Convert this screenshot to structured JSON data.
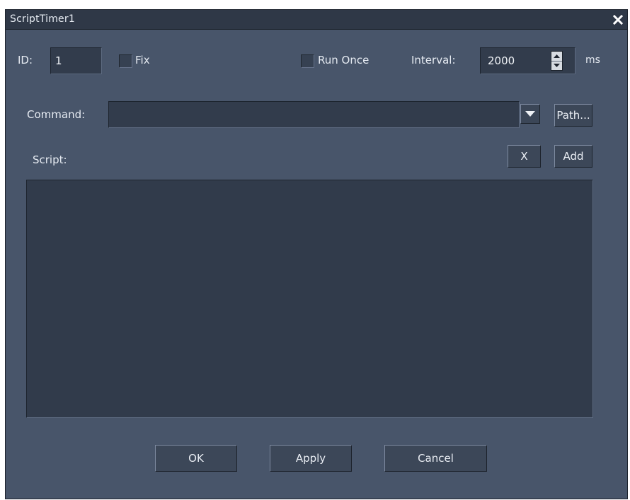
{
  "window": {
    "title": "ScriptTimer1"
  },
  "icons": {
    "close": "close-icon",
    "spin_up": "arrow-up-icon",
    "spin_down": "arrow-down-icon",
    "dropdown": "chevron-down-icon"
  },
  "id": {
    "label": "ID:",
    "value": "1"
  },
  "fix": {
    "label": "Fix",
    "checked": false
  },
  "run_once": {
    "label": "Run Once",
    "checked": false
  },
  "interval": {
    "label": "Interval:",
    "value": "2000",
    "unit": "ms"
  },
  "command": {
    "label": "Command:",
    "value": "",
    "path_button": "Path..."
  },
  "script": {
    "label": "Script:",
    "clear_button": "X",
    "add_button": "Add",
    "content": ""
  },
  "footer": {
    "ok": "OK",
    "apply": "Apply",
    "cancel": "Cancel"
  },
  "colors": {
    "background": "#48556a",
    "field": "#323c4c",
    "titlebar": "#2f3847",
    "text": "#e6ebf2"
  }
}
